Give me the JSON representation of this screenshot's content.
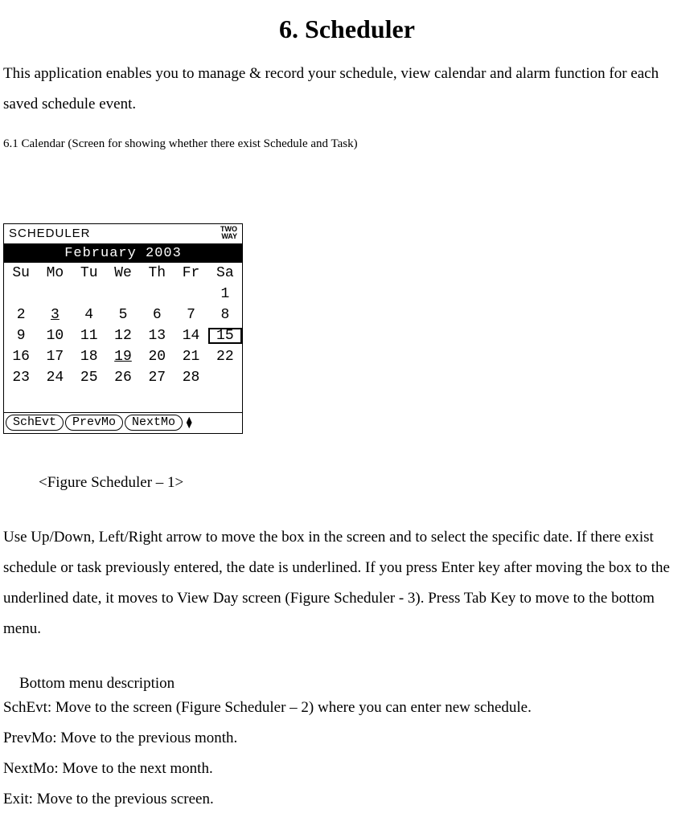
{
  "title": "6. Scheduler",
  "intro": "This application enables you to manage & record your schedule, view calendar and alarm function for each saved schedule event.",
  "section_heading": "6.1 Calendar (Screen for showing whether there exist Schedule and Task)",
  "device": {
    "app_title": "SCHEDULER",
    "status": {
      "line1": "TWO",
      "line2": "WAY"
    },
    "month_label": "February 2003",
    "day_headers": [
      "Su",
      "Mo",
      "Tu",
      "We",
      "Th",
      "Fr",
      "Sa"
    ],
    "rows": [
      [
        "",
        "",
        "",
        "",
        "",
        "",
        "1"
      ],
      [
        "2",
        "3",
        "4",
        "5",
        "6",
        "7",
        "8"
      ],
      [
        "9",
        "10",
        "11",
        "12",
        "13",
        "14",
        "15"
      ],
      [
        "16",
        "17",
        "18",
        "19",
        "20",
        "21",
        "22"
      ],
      [
        "23",
        "24",
        "25",
        "26",
        "27",
        "28",
        ""
      ]
    ],
    "underlined_dates": [
      "3",
      "19"
    ],
    "selected_date": "15",
    "softkeys": [
      "SchEvt",
      "PrevMo",
      "NextMo"
    ],
    "more_indicator": "⧫"
  },
  "figure_caption": "<Figure Scheduler – 1>",
  "instructions": "Use Up/Down, Left/Right arrow to move the box in the screen and to select the specific date. If there exist schedule or task previously entered, the date is underlined. If you press Enter key after moving the box to the underlined date, it moves to View Day screen (Figure Scheduler - 3). Press Tab Key to move to the bottom menu.",
  "bottom_menu_heading": "Bottom menu description",
  "bottom_menu": {
    "schevt": "SchEvt: Move to the screen (Figure Scheduler – 2) where you can enter new schedule.",
    "prevmo": "PrevMo: Move to the previous month.",
    "nextmo": "NextMo: Move to the next month.",
    "exit": "Exit: Move to the previous screen."
  }
}
